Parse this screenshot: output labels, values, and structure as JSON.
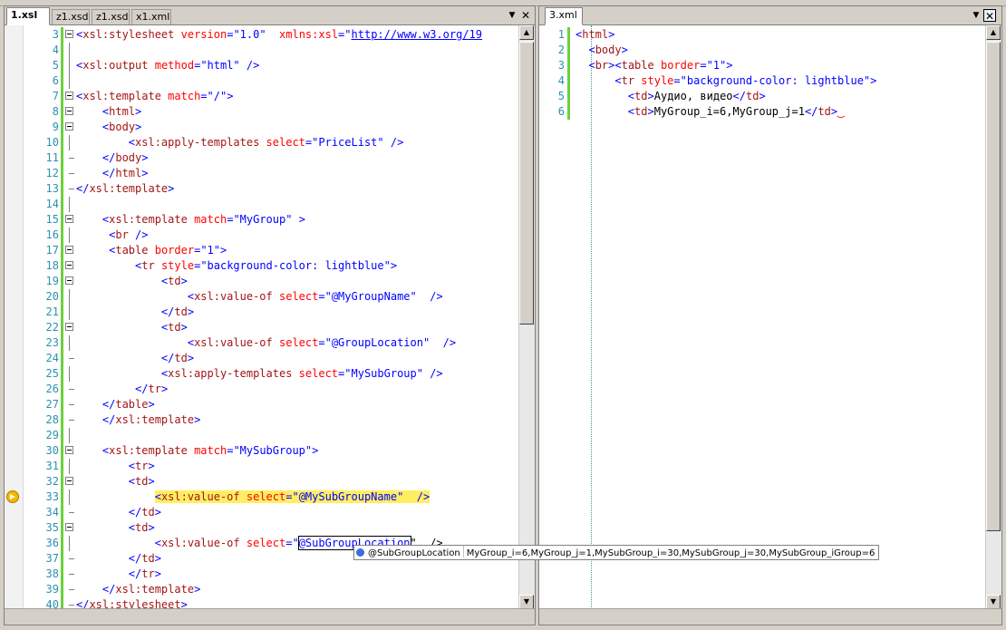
{
  "left_pane": {
    "tabs": [
      "1.xsl",
      "z1.xsd",
      "z1.xsd",
      "x1.xml"
    ],
    "dropdown_glyph": "▼",
    "close_glyph": "✕",
    "lines": [
      {
        "n": "3",
        "code": "<xsl:stylesheet version=\"1.0\"  xmlns:xsl=\"http://www.w3.org/19"
      },
      {
        "n": "4",
        "code": ""
      },
      {
        "n": "5",
        "code": "<xsl:output method=\"html\" />"
      },
      {
        "n": "6",
        "code": ""
      },
      {
        "n": "7",
        "code": "<xsl:template match=\"/\">"
      },
      {
        "n": "8",
        "code": "    <html>"
      },
      {
        "n": "9",
        "code": "    <body>"
      },
      {
        "n": "10",
        "code": "        <xsl:apply-templates select=\"PriceList\" />"
      },
      {
        "n": "11",
        "code": "    </body>"
      },
      {
        "n": "12",
        "code": "    </html>"
      },
      {
        "n": "13",
        "code": "</xsl:template>"
      },
      {
        "n": "14",
        "code": ""
      },
      {
        "n": "15",
        "code": "    <xsl:template match=\"MyGroup\" >"
      },
      {
        "n": "16",
        "code": "     <br />"
      },
      {
        "n": "17",
        "code": "     <table border=\"1\">"
      },
      {
        "n": "18",
        "code": "         <tr style=\"background-color: lightblue\">"
      },
      {
        "n": "19",
        "code": "             <td>"
      },
      {
        "n": "20",
        "code": "                 <xsl:value-of select=\"@MyGroupName\"  />"
      },
      {
        "n": "21",
        "code": "             </td>"
      },
      {
        "n": "22",
        "code": "             <td>"
      },
      {
        "n": "23",
        "code": "                 <xsl:value-of select=\"@GroupLocation\"  />"
      },
      {
        "n": "24",
        "code": "             </td>"
      },
      {
        "n": "25",
        "code": "             <xsl:apply-templates select=\"MySubGroup\" />"
      },
      {
        "n": "26",
        "code": "         </tr>"
      },
      {
        "n": "27",
        "code": "    </table>"
      },
      {
        "n": "28",
        "code": "    </xsl:template>"
      },
      {
        "n": "29",
        "code": ""
      },
      {
        "n": "30",
        "code": "    <xsl:template match=\"MySubGroup\">"
      },
      {
        "n": "31",
        "code": "        <tr>"
      },
      {
        "n": "32",
        "code": "        <td>"
      },
      {
        "n": "33",
        "code": "            <xsl:value-of select=\"@MySubGroupName\"  />"
      },
      {
        "n": "34",
        "code": "        </td>"
      },
      {
        "n": "35",
        "code": "        <td>"
      },
      {
        "n": "36",
        "code": "            <xsl:value-of select=\"@SubGroupLocation\"  />"
      },
      {
        "n": "37",
        "code": "        </td>"
      },
      {
        "n": "38",
        "code": "        </tr>"
      },
      {
        "n": "39",
        "code": "    </xsl:template>"
      },
      {
        "n": "40",
        "code": "</xsl:stylesheet>"
      }
    ]
  },
  "right_pane": {
    "tabs": [
      "3.xml"
    ],
    "dropdown_glyph": "▼",
    "close_glyph": "✕",
    "lines": [
      {
        "n": "1",
        "code": "<html>"
      },
      {
        "n": "2",
        "code": "  <body>"
      },
      {
        "n": "3",
        "code": "  <br><table border=\"1\">"
      },
      {
        "n": "4",
        "code": "      <tr style=\"background-color: lightblue\">"
      },
      {
        "n": "5",
        "code": "        <td>Аудио, видео</td>"
      },
      {
        "n": "6",
        "code": "        <td>MyGroup_i=6,MyGroup_j=1</td>"
      }
    ]
  },
  "tooltip": {
    "name": "@SubGroupLocation",
    "value": "MyGroup_i=6,MyGroup_j=1,MySubGroup_i=30,MySubGroup_j=30,MySubGroup_iGroup=6"
  },
  "scroll_glyphs": {
    "up": "▲",
    "down": "▼"
  },
  "colors": {
    "xml_bracket": "#0000ff",
    "xml_tag": "#a31515",
    "xml_attribute": "#ff0000",
    "xml_value": "#0000ff",
    "line_number": "#2b91af",
    "changed_marker": "#6bd13c",
    "current_statement": "#ffee62"
  }
}
